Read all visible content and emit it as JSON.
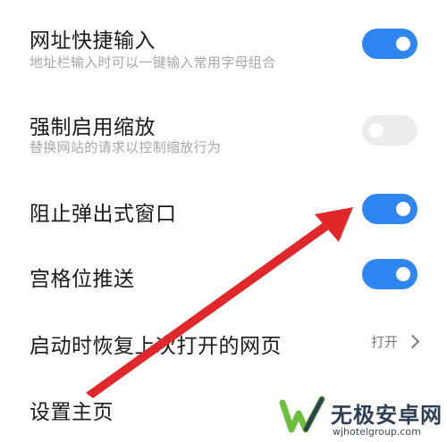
{
  "settings": {
    "items": [
      {
        "title": "网址快捷输入",
        "subtitle": "地址栏输入时可以一键输入常用字母组合",
        "toggle_state": "on"
      },
      {
        "title": "强制启用缩放",
        "subtitle": "替换网站的请求以控制缩放行为",
        "toggle_state": "off"
      },
      {
        "title": "阻止弹出式窗口",
        "toggle_state": "on"
      },
      {
        "title": "宫格位推送",
        "toggle_state": "on"
      },
      {
        "title": "启动时恢复上次打开的网页",
        "value": "打开",
        "icon": "chevron-right-icon"
      },
      {
        "title": "设置主页"
      }
    ]
  },
  "annotation": {
    "icon": "red-arrow-icon",
    "color": "#e0282a"
  },
  "watermark": {
    "title": "无极安卓网",
    "url": "wjhotelgroup.com",
    "logo_icon": "w-check-logo-icon",
    "colors": {
      "green": "#6cbf3a",
      "dark": "#2e3e55"
    }
  },
  "colors": {
    "toggle_on": "#2f86f0",
    "toggle_off": "#ececec",
    "text_primary": "#1a1a1a",
    "text_secondary": "#a8a8a8"
  }
}
